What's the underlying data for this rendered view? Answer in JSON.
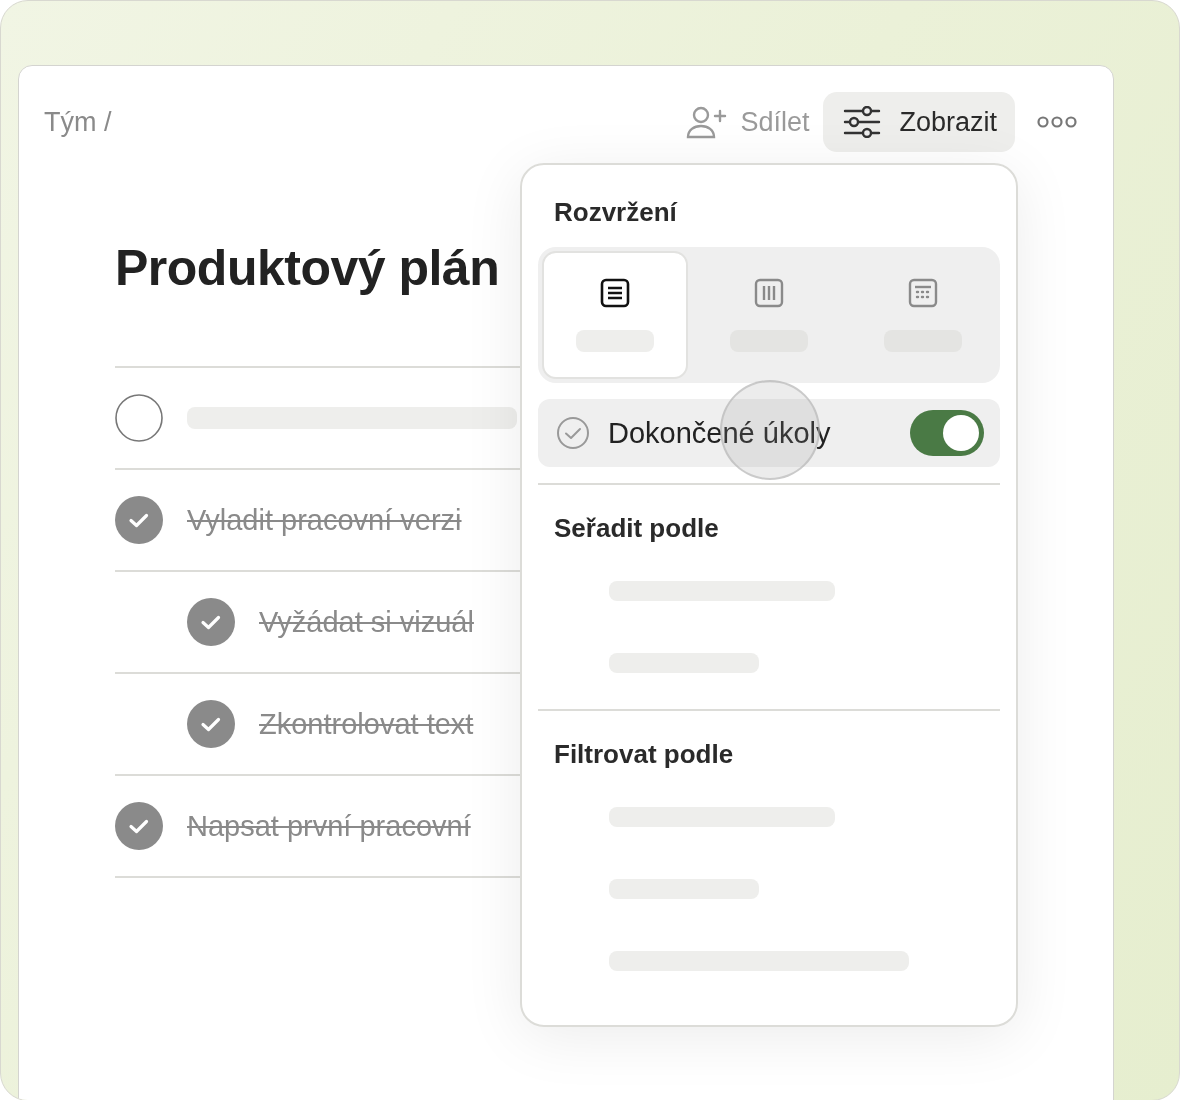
{
  "breadcrumb": "Tým /",
  "toolbar": {
    "share": "Sdílet",
    "view": {
      "label": "Zobrazit",
      "selected": true
    }
  },
  "page_title": "Produktový plán",
  "tasks": [
    {
      "kind": "placeholder",
      "checked": false
    },
    {
      "kind": "task",
      "title": "Vyladit pracovní verzi",
      "checked": true,
      "children": [
        {
          "kind": "task",
          "title": "Vyžádat si vizuál",
          "checked": true
        },
        {
          "kind": "task",
          "title": "Zkontrolovat text",
          "checked": true
        }
      ]
    },
    {
      "kind": "task",
      "title": "Napsat první pracovní",
      "checked": true
    }
  ],
  "view_menu": {
    "layout_title": "Rozvržení",
    "layouts": [
      {
        "kind": "list",
        "selected": true
      },
      {
        "kind": "board",
        "selected": false
      },
      {
        "kind": "calendar",
        "selected": false
      }
    ],
    "completed_toggle": {
      "label": "Dokončené úkoly",
      "on": true
    },
    "sort_title": "Seřadit podle",
    "filter_title": "Filtrovat podle"
  }
}
